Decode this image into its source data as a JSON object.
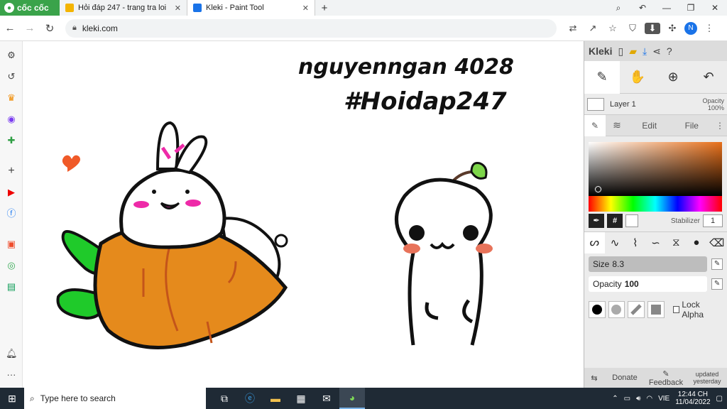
{
  "browser": {
    "brand": "cốc cốc",
    "tabs": [
      {
        "title": "Hỏi đáp 247 - trang tra loi",
        "icon_color": "#f4b400",
        "active": false
      },
      {
        "title": "Kleki - Paint Tool",
        "icon_color": "#1a73e8",
        "active": true
      }
    ],
    "new_tab": "+",
    "address": "kleki.com",
    "profile_initial": "N"
  },
  "sidebar": {
    "icons": [
      "gear-icon",
      "history-icon",
      "crown-icon",
      "messenger-icon",
      "gamepad-icon",
      "plus-icon",
      "youtube-icon",
      "facebook-icon",
      "shopee-icon",
      "maps-icon",
      "sheets-icon",
      "bell-icon",
      "more-icon"
    ]
  },
  "canvas": {
    "handwriting_line1": "nguyenngan 4028",
    "handwriting_line2": "#Hoidap247"
  },
  "kleki": {
    "logo": "Kleki",
    "layer_name": "Layer 1",
    "opacity_label": "Opacity",
    "opacity_value": "100%",
    "tabs": {
      "edit": "Edit",
      "file": "File"
    },
    "hash": "#",
    "stabilizer_label": "Stabilizer",
    "stabilizer_value": "1",
    "size_label": "Size",
    "size_value": "8.3",
    "brush_opacity_label": "Opacity",
    "brush_opacity_value": "100",
    "lock_alpha": "Lock Alpha",
    "footer": {
      "donate": "Donate",
      "feedback": "Feedback",
      "updated1": "updated",
      "updated2": "yesterday"
    },
    "primary_color": "#000000",
    "secondary_color": "#ffffff",
    "hue_color": "#e8701a"
  },
  "taskbar": {
    "search_placeholder": "Type here to search",
    "lang": "VIE",
    "time": "12:44 CH",
    "date": "11/04/2022"
  }
}
